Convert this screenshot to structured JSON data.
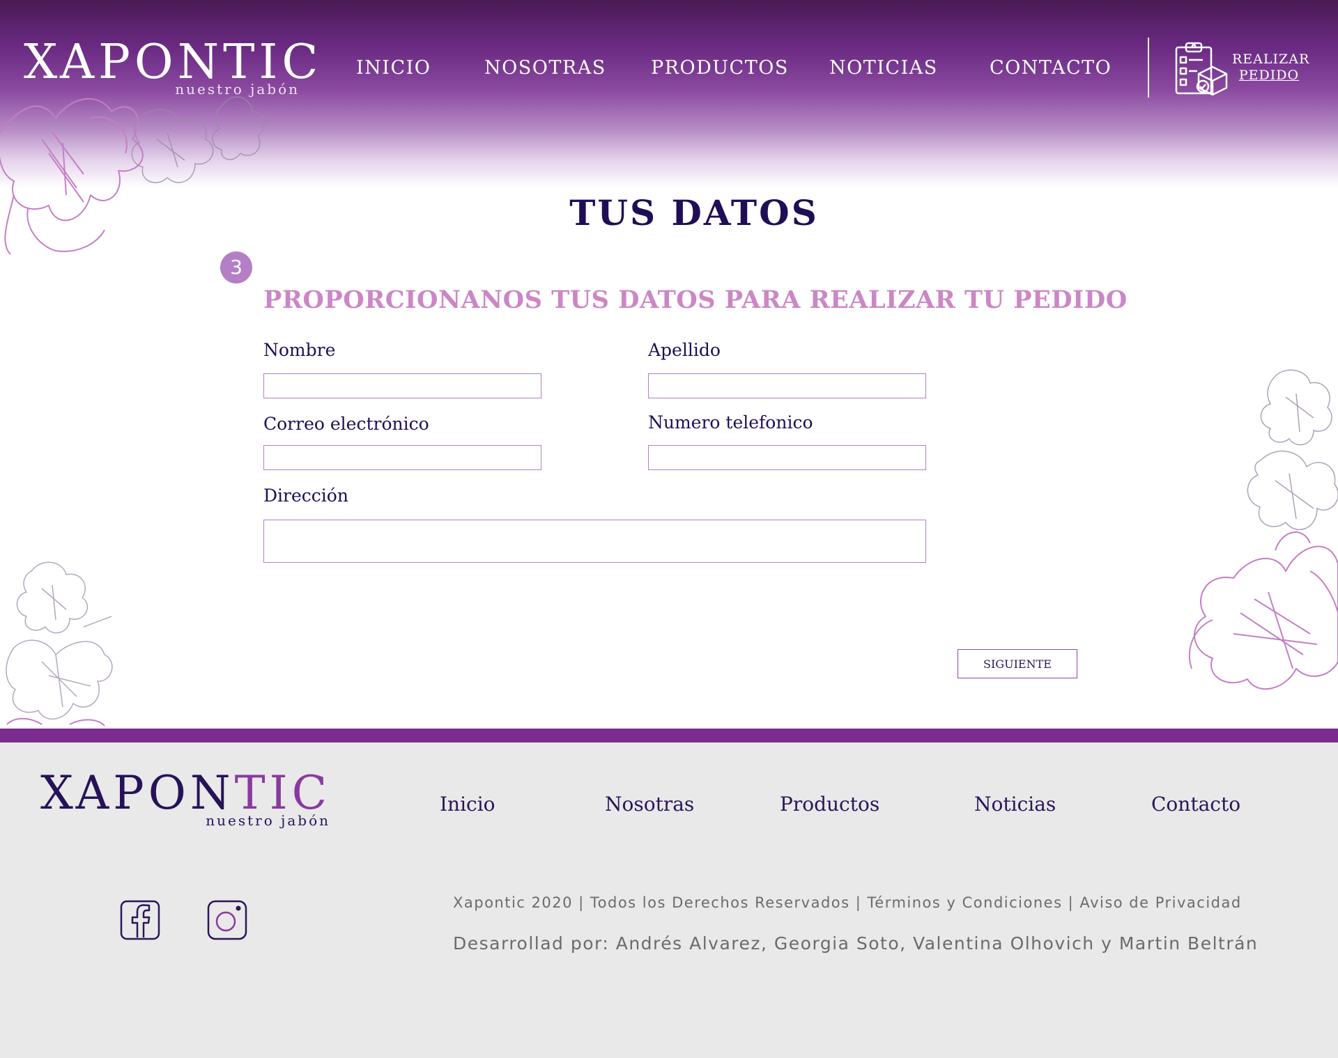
{
  "brand": {
    "name_main": "XAPON",
    "name_accent": "TIC",
    "tagline": "nuestro jabón"
  },
  "nav": {
    "items": [
      "INICIO",
      "NOSOTRAS",
      "PRODUCTOS",
      "NOTICIAS",
      "CONTACTO"
    ],
    "order_button": {
      "line1": "REALIZAR",
      "line2": "PEDIDO"
    }
  },
  "page": {
    "title": "TUS DATOS",
    "step_number": "3",
    "subtitle": "PROPORCIONANOS TUS DATOS PARA REALIZAR TU PEDIDO"
  },
  "form": {
    "first_name_label": "Nombre",
    "last_name_label": "Apellido",
    "email_label": "Correo electrónico",
    "phone_label": "Numero telefonico",
    "address_label": "Dirección",
    "first_name_value": "",
    "last_name_value": "",
    "email_value": "",
    "phone_value": "",
    "address_value": "",
    "next_button": "SIGUIENTE"
  },
  "footer": {
    "nav": [
      "Inicio",
      "Nosotras",
      "Productos",
      "Noticias",
      "Contacto"
    ],
    "social_icons": [
      "facebook-icon",
      "instagram-icon"
    ],
    "legal": "Xapontic 2020 | Todos los Derechos Reservados | Términos y Condiciones | Aviso de Privacidad",
    "credits": "Desarrollad por: Andrés Alvarez, Georgia Soto, Valentina Olhovich y Martin Beltrán"
  },
  "colors": {
    "header_dark": "#4a1a55",
    "accent_purple": "#7c2b91",
    "title_navy": "#1f0e56",
    "subtitle_pink": "#cc86c6",
    "input_border": "#b47fc4",
    "footer_bg": "#e9e9e9"
  }
}
